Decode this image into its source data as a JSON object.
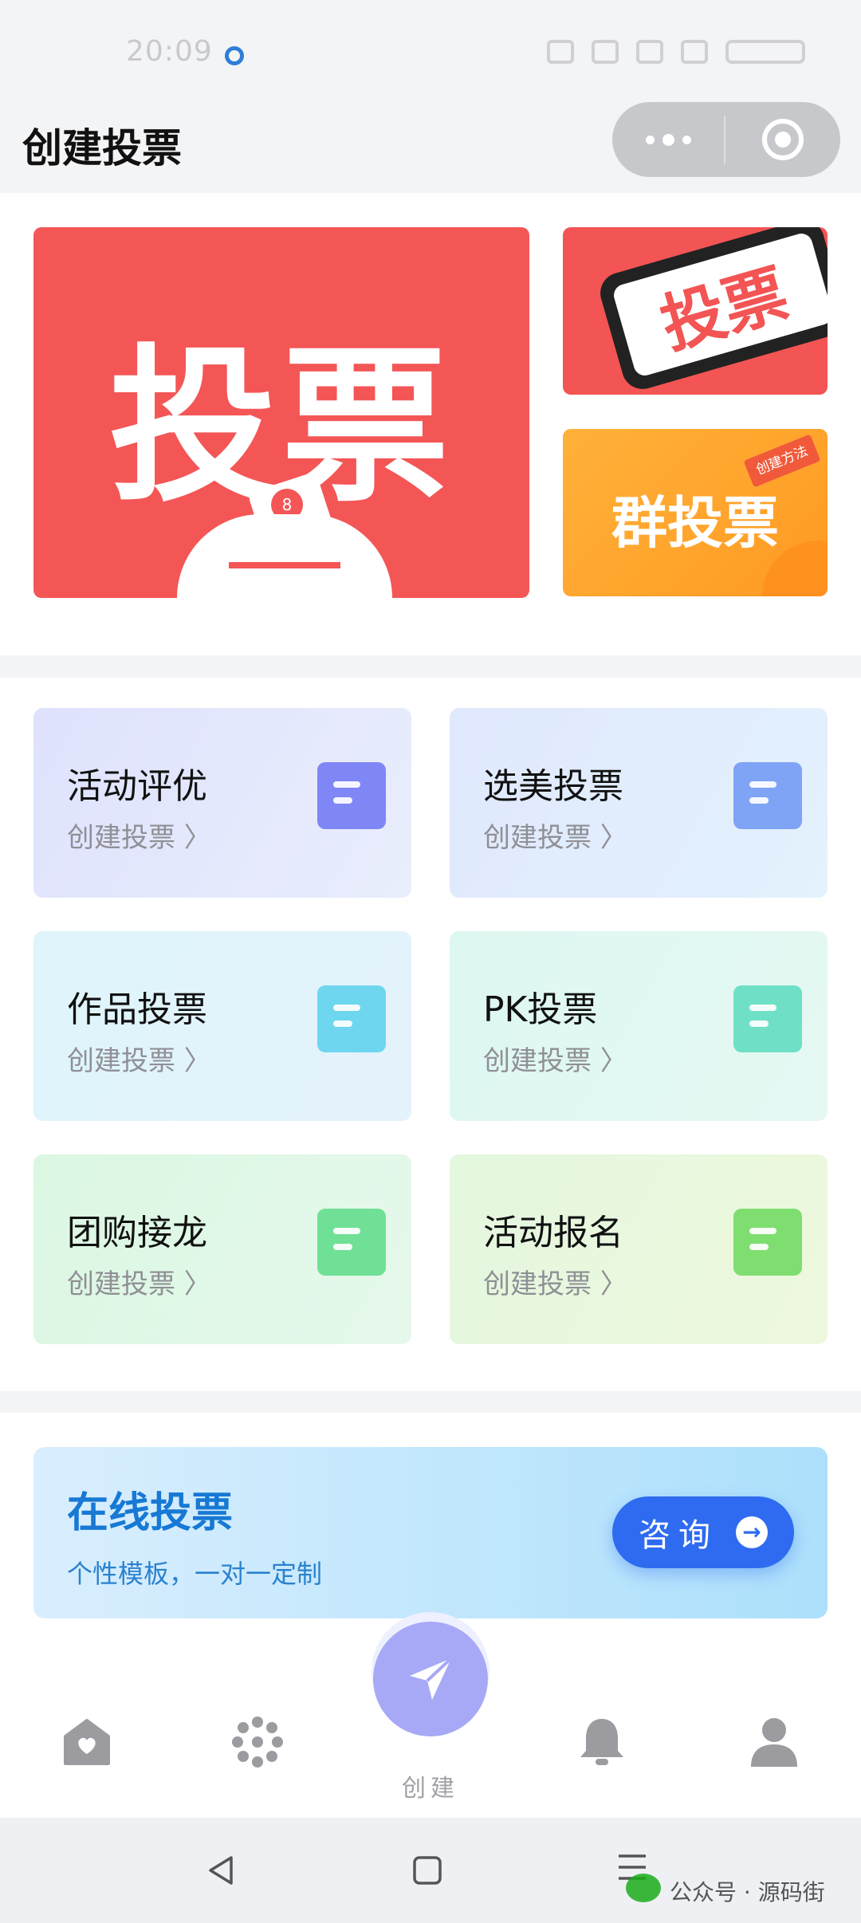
{
  "status_bar": {
    "time": "20:09"
  },
  "header": {
    "title": "创建投票"
  },
  "banners": {
    "main_text": "投票",
    "phone_text": "投票",
    "group_text": "群投票",
    "group_tag": "创建方法",
    "badge": "8"
  },
  "cards": [
    {
      "title": "活动评优",
      "sub": "创建投票 〉",
      "color": "#7f86f5"
    },
    {
      "title": "选美投票",
      "sub": "创建投票 〉",
      "color": "#7fa4f5"
    },
    {
      "title": "作品投票",
      "sub": "创建投票 〉",
      "color": "#6fd6f0"
    },
    {
      "title": "PK投票",
      "sub": "创建投票 〉",
      "color": "#6fe0c6"
    },
    {
      "title": "团购接龙",
      "sub": "创建投票 〉",
      "color": "#6fe096"
    },
    {
      "title": "活动报名",
      "sub": "创建投票 〉",
      "color": "#7fde70"
    }
  ],
  "online": {
    "title": "在线投票",
    "subtitle": "个性模板，一对一定制",
    "consult_label": "咨询",
    "consult_arrow": "→"
  },
  "tabbar": {
    "create_label": "创建"
  },
  "watermark": {
    "text": "公众号 · 源码街"
  },
  "colors": {
    "accent": "#2e6bf0",
    "banner_red": "#f45656",
    "banner_orange": "#ff9a22",
    "fab": "#a7a9f6"
  }
}
